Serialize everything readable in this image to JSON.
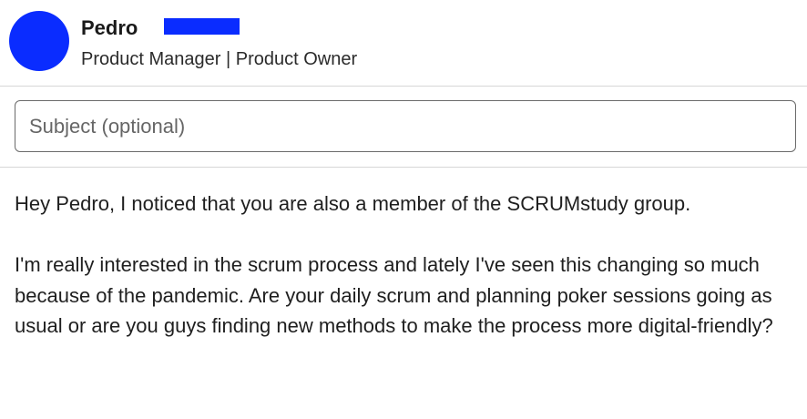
{
  "profile": {
    "name": "Pedro",
    "headline": "Product Manager | Product Owner",
    "avatar_color": "#0a2cff",
    "redaction_color": "#0a2cff"
  },
  "subject": {
    "placeholder": "Subject (optional)",
    "value": ""
  },
  "message": {
    "paragraphs": [
      "Hey Pedro, I noticed that you are also a member of the SCRUMstudy group.",
      "I'm really interested in the scrum process and lately I've seen this changing so much because of the pandemic. Are your daily scrum and planning poker sessions going as usual or are you guys finding new methods to make the process more digital-friendly?"
    ]
  }
}
